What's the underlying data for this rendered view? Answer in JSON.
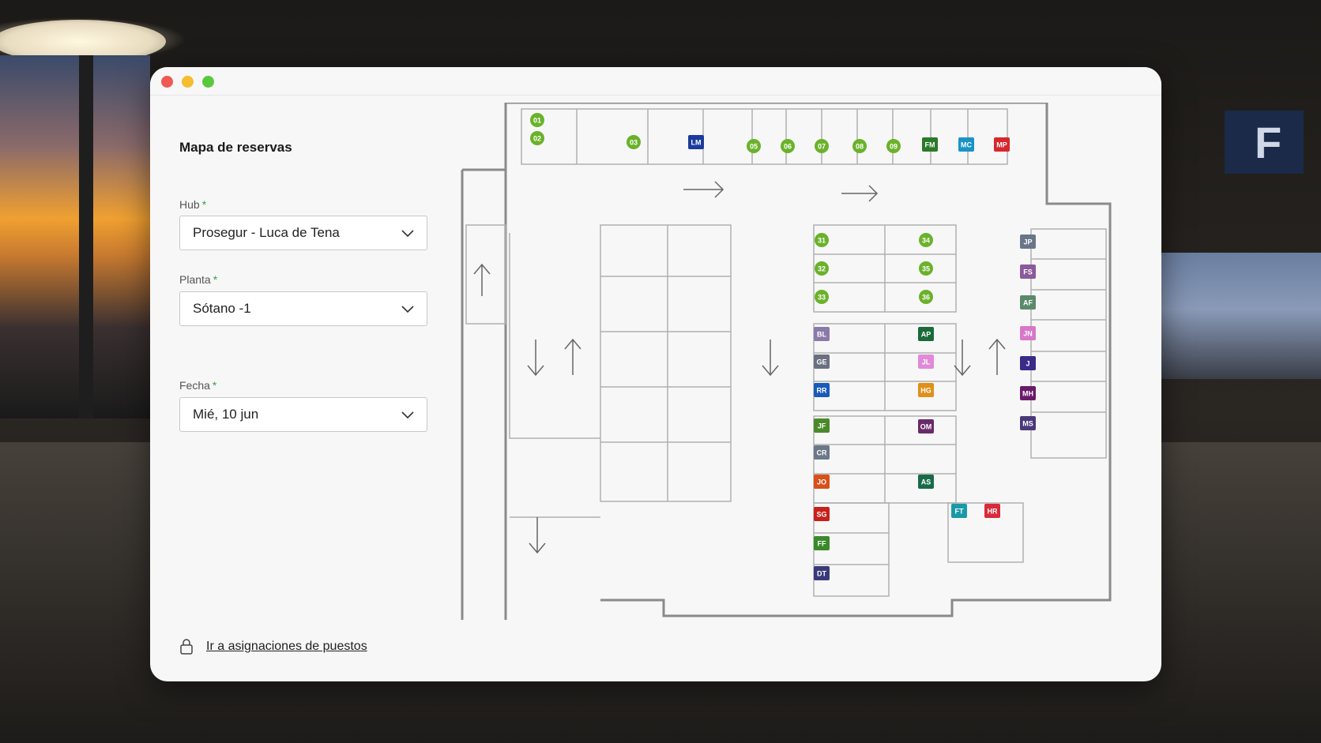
{
  "window": {
    "controls": [
      "close",
      "minimize",
      "maximize"
    ]
  },
  "sidebar": {
    "title": "Mapa de reservas",
    "hub": {
      "label": "Hub",
      "required": "*",
      "value": "Prosegur - Luca de Tena"
    },
    "planta": {
      "label": "Planta",
      "required": "*",
      "value": "Sótano -1"
    },
    "fecha": {
      "label": "Fecha",
      "required": "*",
      "value": "Mié, 10 jun"
    },
    "link": {
      "text": "Ir a asignaciones de puestos",
      "icon": "lock-icon"
    }
  },
  "map": {
    "colors": {
      "available": "#6ab22a",
      "wall": "#8a8a8a"
    },
    "available_desks": [
      "01",
      "02",
      "03",
      "05",
      "06",
      "07",
      "08",
      "09",
      "31",
      "32",
      "33",
      "34",
      "35",
      "36"
    ],
    "booked_desks": [
      {
        "initials": "LM",
        "color": "#1b3b9c"
      },
      {
        "initials": "FM",
        "color": "#2a7a2a"
      },
      {
        "initials": "MC",
        "color": "#1b93c8"
      },
      {
        "initials": "MP",
        "color": "#d9262c"
      },
      {
        "initials": "JP",
        "color": "#6a7688"
      },
      {
        "initials": "FS",
        "color": "#8a5a9a"
      },
      {
        "initials": "AF",
        "color": "#5a8a6a"
      },
      {
        "initials": "JN",
        "color": "#d878c8"
      },
      {
        "initials": "J",
        "color": "#3a2a8a"
      },
      {
        "initials": "MH",
        "color": "#6a1a6a"
      },
      {
        "initials": "MS",
        "color": "#4a3a7a"
      },
      {
        "initials": "BL",
        "color": "#8a7aa8"
      },
      {
        "initials": "AP",
        "color": "#1a6a3a"
      },
      {
        "initials": "GE",
        "color": "#6a7080"
      },
      {
        "initials": "JL",
        "color": "#e08ad8"
      },
      {
        "initials": "RR",
        "color": "#1a5ab8"
      },
      {
        "initials": "HG",
        "color": "#e0901a"
      },
      {
        "initials": "JF",
        "color": "#4a8a2a"
      },
      {
        "initials": "OM",
        "color": "#6a2a6a"
      },
      {
        "initials": "CR",
        "color": "#6a7888"
      },
      {
        "initials": "JO",
        "color": "#d8501a"
      },
      {
        "initials": "AS",
        "color": "#1a6a4a"
      },
      {
        "initials": "SG",
        "color": "#c8201a"
      },
      {
        "initials": "FT",
        "color": "#1a9aa8"
      },
      {
        "initials": "HR",
        "color": "#d82a3a"
      },
      {
        "initials": "FF",
        "color": "#3a8a2a"
      },
      {
        "initials": "DT",
        "color": "#3a3a7a"
      }
    ]
  }
}
